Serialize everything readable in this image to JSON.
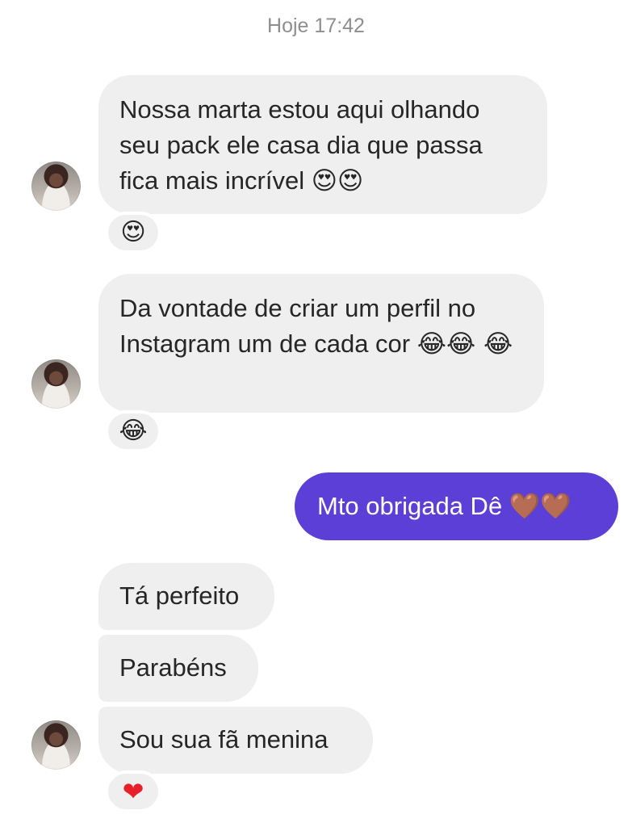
{
  "timestamp": "Hoje 17:42",
  "messages": [
    {
      "text": "Nossa marta estou aqui olhando seu pack ele casa dia que passa fica mais incrível",
      "emoji": "😍😍",
      "reaction": "😍"
    },
    {
      "text": "Da vontade de criar um perfil no Instagram um de cada cor",
      "emoji": "😂😂 😂",
      "reaction": "😂"
    },
    {
      "text": "Mto obrigada Dê",
      "emoji": "🤎🤎"
    },
    {
      "text": "Tá perfeito"
    },
    {
      "text": "Parabéns"
    },
    {
      "text": "Sou sua fã menina",
      "reaction": "❤"
    }
  ],
  "colors": {
    "received_bubble": "#efefef",
    "sent_bubble": "#5b3fd6",
    "timestamp": "#8e8e8e"
  }
}
